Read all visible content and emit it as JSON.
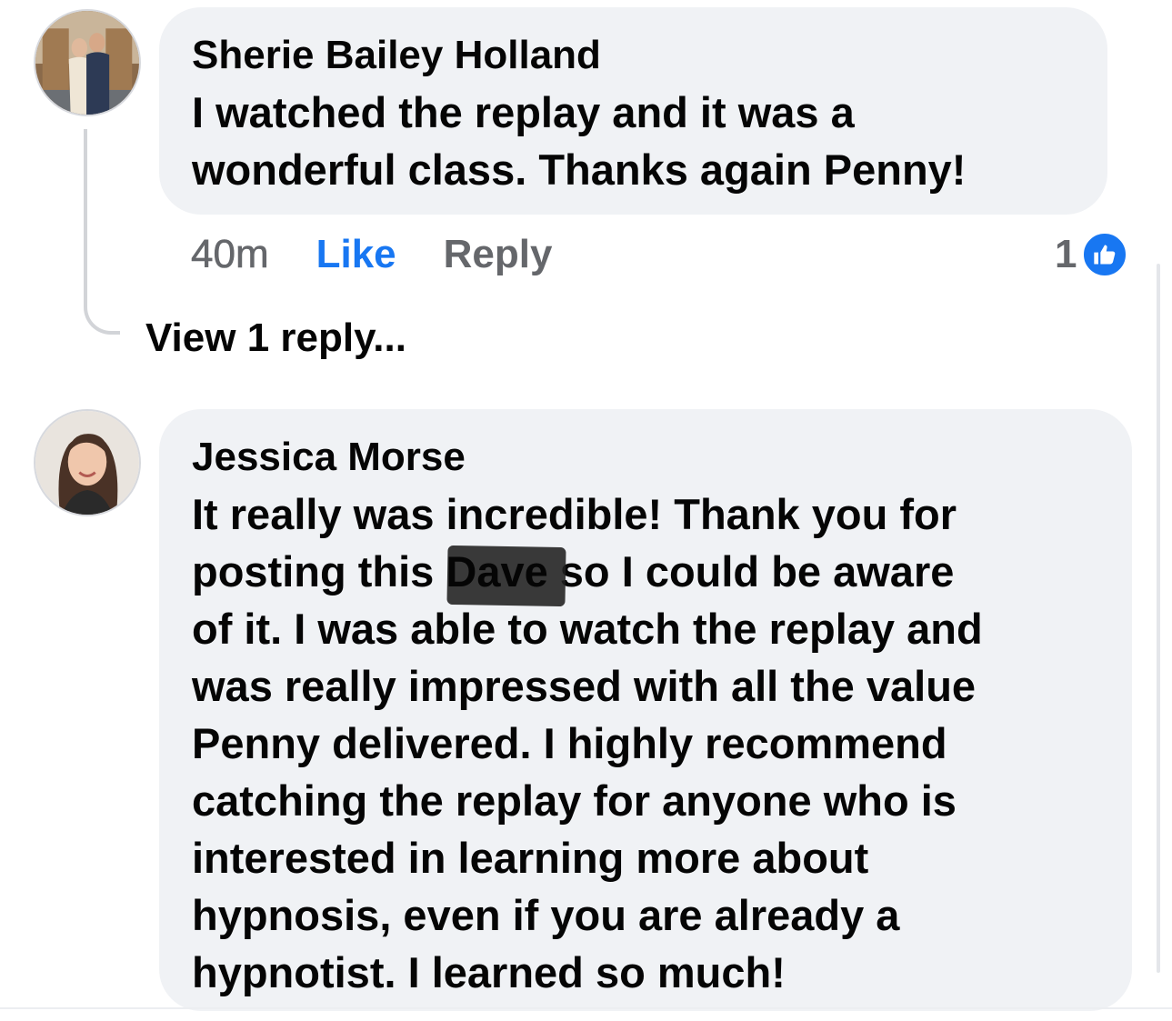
{
  "comments": [
    {
      "author": "Sherie Bailey Holland",
      "lines": [
        "I watched the replay and it was a",
        "wonderful class. Thanks again Penny!"
      ],
      "time": "40m",
      "like_label": "Like",
      "reply_label": "Reply",
      "reaction_count": "1",
      "reaction_icon": "thumbs-up-icon",
      "view_replies": "View 1 reply..."
    },
    {
      "author": "Jessica Morse",
      "line1": "It really was incredible! Thank you for",
      "line2_before": "posting this ",
      "line2_redacted": "Dave",
      "line2_after": " so I could be aware",
      "lines_rest": [
        "of it. I was able to watch the replay and",
        "was really impressed with all the value",
        "Penny delivered. I highly recommend",
        "catching the replay for anyone who is",
        "interested in learning more about",
        "hypnosis, even if you are already a",
        "hypnotist. I learned so much!"
      ]
    }
  ],
  "colors": {
    "bubble": "#f0f2f5",
    "like": "#1877f2",
    "meta": "#65676b"
  }
}
